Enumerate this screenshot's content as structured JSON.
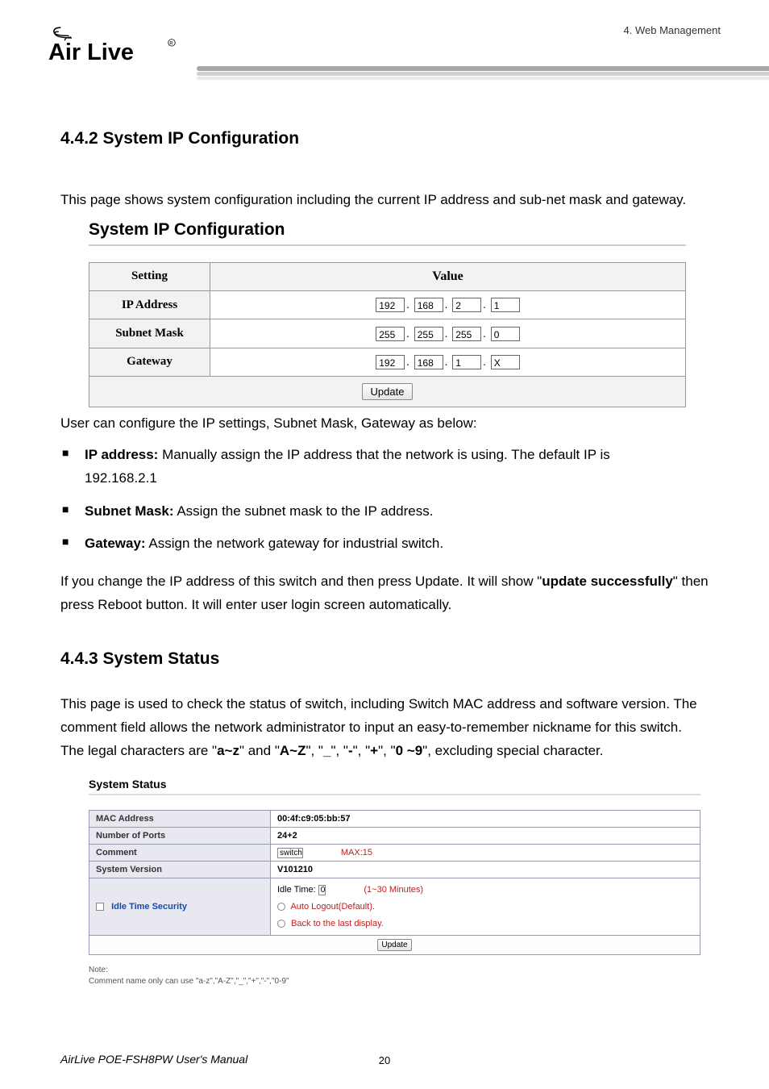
{
  "header": {
    "chapter": "4.  Web Management",
    "logo_text": "Air Live"
  },
  "sec442": {
    "title": "4.4.2 System IP Configuration",
    "intro": "This page shows system configuration including the current IP address and sub-net mask and gateway.",
    "panel_title": "System IP Configuration",
    "table": {
      "col_setting": "Setting",
      "col_value": "Value",
      "rows": [
        {
          "label": "IP Address",
          "octets": [
            "192",
            "168",
            "2",
            "1"
          ]
        },
        {
          "label": "Subnet Mask",
          "octets": [
            "255",
            "255",
            "255",
            "0"
          ]
        },
        {
          "label": "Gateway",
          "octets": [
            "192",
            "168",
            "1",
            "X"
          ]
        }
      ],
      "update_btn": "Update"
    },
    "after_table": "User can configure the IP settings, Subnet Mask, Gateway as below:",
    "bullets": {
      "ip_label": "IP address:",
      "ip_text": " Manually assign the IP address that the network is using. The default IP is",
      "ip_sub": "192.168.2.1",
      "subnet_label": "Subnet Mask:",
      "subnet_text": " Assign the subnet mask to the IP address.",
      "gateway_label": "Gateway:",
      "gateway_text": " Assign the network gateway for industrial switch."
    },
    "update_note_1": "If you change the IP address of this switch and then press Update. It will show \"",
    "update_note_bold": "update successfully",
    "update_note_2": "\" then press Reboot button. It will enter user login screen automatically."
  },
  "sec443": {
    "title": "4.4.3 System Status",
    "p1": "This page is used to check the status of switch, including Switch MAC address and software version. The comment field allows the network administrator to input an easy-to-remember nickname for this switch. The legal characters are \"",
    "p1_b1": "a~z",
    "p1_t2": "\" and \"",
    "p1_b2": "A~Z",
    "p1_t3": "\", \"",
    "p1_b3": "_",
    "p1_t4": "\", \"",
    "p1_b4": "-",
    "p1_t5": "\", \"",
    "p1_b5": "+",
    "p1_t6": "\", \"",
    "p1_b6": "0 ~9",
    "p1_t7": "\", excluding special character.",
    "panel_title": "System Status",
    "table": {
      "mac_label": "MAC Address",
      "mac_value": "00:4f:c9:05:bb:57",
      "ports_label": "Number of Ports",
      "ports_value": "24+2",
      "comment_label": "Comment",
      "comment_value": "switch",
      "comment_max": "MAX:15",
      "version_label": "System Version",
      "version_value": "V101210",
      "idle_label": "Idle Time Security",
      "idle_time_label": "Idle Time:",
      "idle_time_value": "0",
      "idle_minutes": "(1~30 Minutes)",
      "auto_logout": "Auto Logout(Default).",
      "back_display": "Back to the last display.",
      "update_btn": "Update"
    },
    "note_label": "Note:",
    "note_text": "Comment name only can use \"a-z\",\"A-Z\",\"_\",\"+\",\"-\",\"0-9\""
  },
  "footer": {
    "manual": "AirLive POE-FSH8PW User's Manual",
    "page_num": "20"
  }
}
